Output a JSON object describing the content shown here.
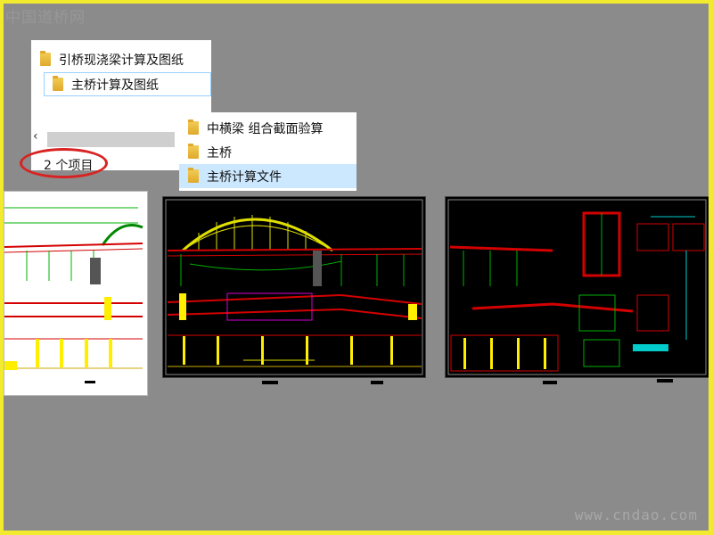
{
  "watermark_top": "中国道桥网",
  "watermark_bottom": "www.cndao.com",
  "parent_folder": {
    "items": [
      {
        "label": "引桥现浇梁计算及图纸"
      },
      {
        "label": "主桥计算及图纸"
      }
    ],
    "item_count": "2 个项目"
  },
  "child_folder": {
    "items": [
      {
        "label": "中横梁 组合截面验算"
      },
      {
        "label": "主桥"
      },
      {
        "label": "主桥计算文件"
      }
    ]
  },
  "colors": {
    "highlight_ring": "#d92222",
    "selection": "#cce8ff",
    "frame": "#f2ea2e"
  },
  "thumbnails": [
    {
      "name": "bridge-elevation-drawing-1"
    },
    {
      "name": "arch-bridge-elevation-drawing"
    },
    {
      "name": "pier-detail-drawing"
    }
  ]
}
